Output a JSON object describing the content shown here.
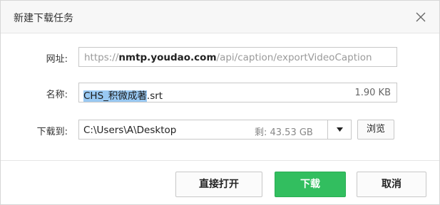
{
  "dialog": {
    "title": "新建下载任务",
    "close_icon": "close-icon"
  },
  "url_row": {
    "label": "网址:",
    "prefix": "https://",
    "host": "nmtp.youdao.com",
    "path": "/api/caption/exportVideoCaption"
  },
  "name_row": {
    "label": "名称:",
    "filename_selected": "CHS_积微成著",
    "filename_ext": ".srt",
    "size": "1.90 KB"
  },
  "save_row": {
    "label": "下载到:",
    "path": "C:\\Users\\A\\Desktop",
    "free_space": "剩: 43.53 GB",
    "dropdown_icon": "triangle-down-icon",
    "browse_label": "浏览"
  },
  "buttons": {
    "open_label": "直接打开",
    "download_label": "下载",
    "cancel_label": "取消"
  },
  "colors": {
    "accent_green": "#32be5f",
    "selection_blue": "#99c9f3"
  }
}
